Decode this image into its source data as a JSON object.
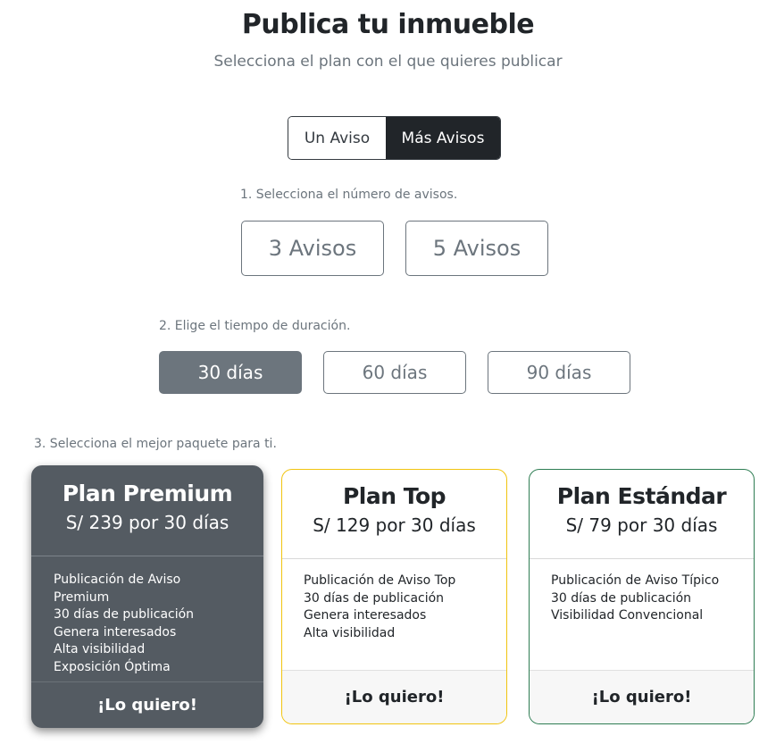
{
  "header": {
    "title": "Publica tu inmueble",
    "subtitle": "Selecciona el plan con el que quieres publicar"
  },
  "mode_toggle": {
    "options": [
      "Un Aviso",
      "Más Avisos"
    ],
    "selected": "Más Avisos"
  },
  "step1": {
    "label": "1. Selecciona el número de avisos.",
    "options": [
      "3 Avisos",
      "5 Avisos"
    ]
  },
  "step2": {
    "label": "2. Elige el tiempo de duración.",
    "options": [
      "30 días",
      "60 días",
      "90 días"
    ],
    "selected": "30 días"
  },
  "step3": {
    "label": "3. Selecciona el mejor paquete para ti."
  },
  "plans": [
    {
      "name": "Plan Premium",
      "price": "S/ 239 por 30 días",
      "features": [
        "Publicación de Aviso",
        "Premium",
        "30 días de publicación",
        "Genera interesados",
        "Alta visibilidad",
        "Exposición Óptima"
      ],
      "cta": "¡Lo quiero!",
      "selected": true,
      "color": "#545b62"
    },
    {
      "name": "Plan Top",
      "price": "S/ 129 por 30 días",
      "features": [
        "Publicación de Aviso Top",
        "30 días de publicación",
        "Genera interesados",
        "Alta visibilidad"
      ],
      "cta": "¡Lo quiero!",
      "selected": false,
      "color": "#f1c40f"
    },
    {
      "name": "Plan Estándar",
      "price": "S/ 79 por 30 días",
      "features": [
        "Publicación de Aviso Típico",
        "30 días de publicación",
        "Visibilidad Convencional"
      ],
      "cta": "¡Lo quiero!",
      "selected": false,
      "color": "#2e7d53"
    }
  ]
}
